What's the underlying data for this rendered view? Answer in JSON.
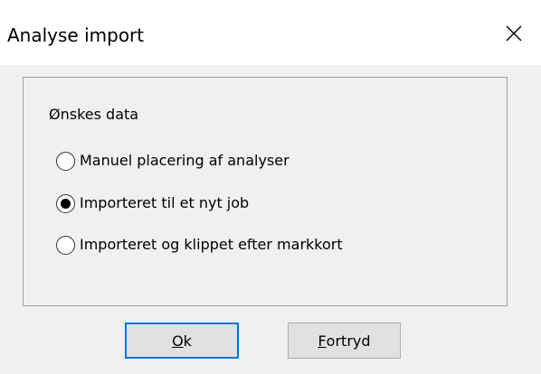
{
  "window": {
    "title": "Analyse import",
    "close_icon": "close-icon"
  },
  "group": {
    "label": "Ønskes data"
  },
  "options": [
    {
      "label": "Manuel placering af analyser",
      "selected": false
    },
    {
      "label": "Importeret til et nyt job",
      "selected": true
    },
    {
      "label": "Importeret og klippet efter markkort",
      "selected": false
    }
  ],
  "buttons": {
    "ok": {
      "accel": "O",
      "rest": "k"
    },
    "cancel": {
      "accel": "F",
      "rest": "ortryd"
    }
  },
  "colors": {
    "accent": "#0078d7",
    "dialog_bg": "#f0f0f0",
    "button_bg": "#e1e1e1"
  }
}
